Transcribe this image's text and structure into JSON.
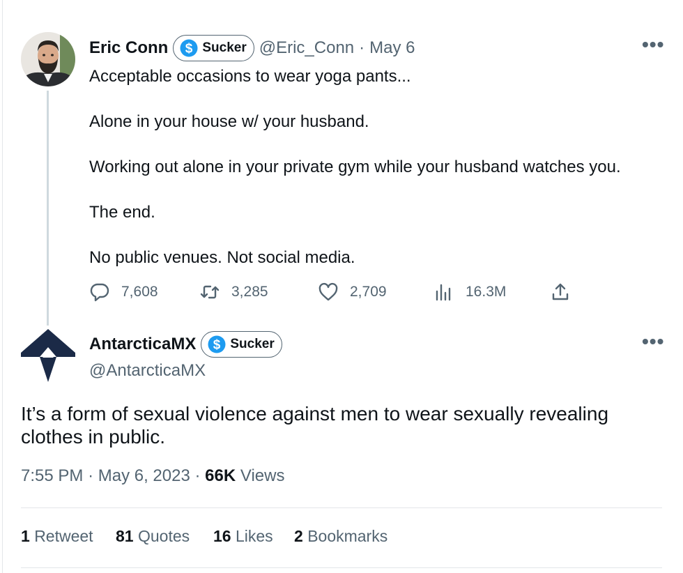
{
  "tweet1": {
    "author_name": "Eric Conn",
    "badge_label": "Sucker",
    "handle": "@Eric_Conn",
    "separator": "·",
    "date": "May 6",
    "more_label": "•••",
    "lines": [
      "Acceptable occasions to wear yoga pants...",
      "",
      "Alone in your house w/ your husband.",
      "",
      "Working out alone in your private gym while your husband watches you.",
      "",
      "The end.",
      "",
      "No public venues. Not social media."
    ],
    "actions": {
      "replies": "7,608",
      "retweets": "3,285",
      "likes": "2,709",
      "views": "16.3M"
    }
  },
  "tweet2": {
    "author_name": "AntarcticaMX",
    "badge_label": "Sucker",
    "handle": "@AntarcticaMX",
    "more_label": "•••",
    "text": "It’s a form of sexual violence against men to wear sexually revealing clothes in public.",
    "time": "7:55 PM",
    "separator": "·",
    "date": "May 6, 2023",
    "views_count": "66K",
    "views_label": "Views",
    "stats": {
      "retweets_count": "1",
      "retweets_label": "Retweet",
      "quotes_count": "81",
      "quotes_label": "Quotes",
      "likes_count": "16",
      "likes_label": "Likes",
      "bookmarks_count": "2",
      "bookmarks_label": "Bookmarks"
    }
  },
  "colors": {
    "text": "#0f1419",
    "muted": "#536471",
    "badge_blue": "#1d9bf0",
    "thread_line": "#cfd9de",
    "logo_navy": "#1b2a47"
  }
}
